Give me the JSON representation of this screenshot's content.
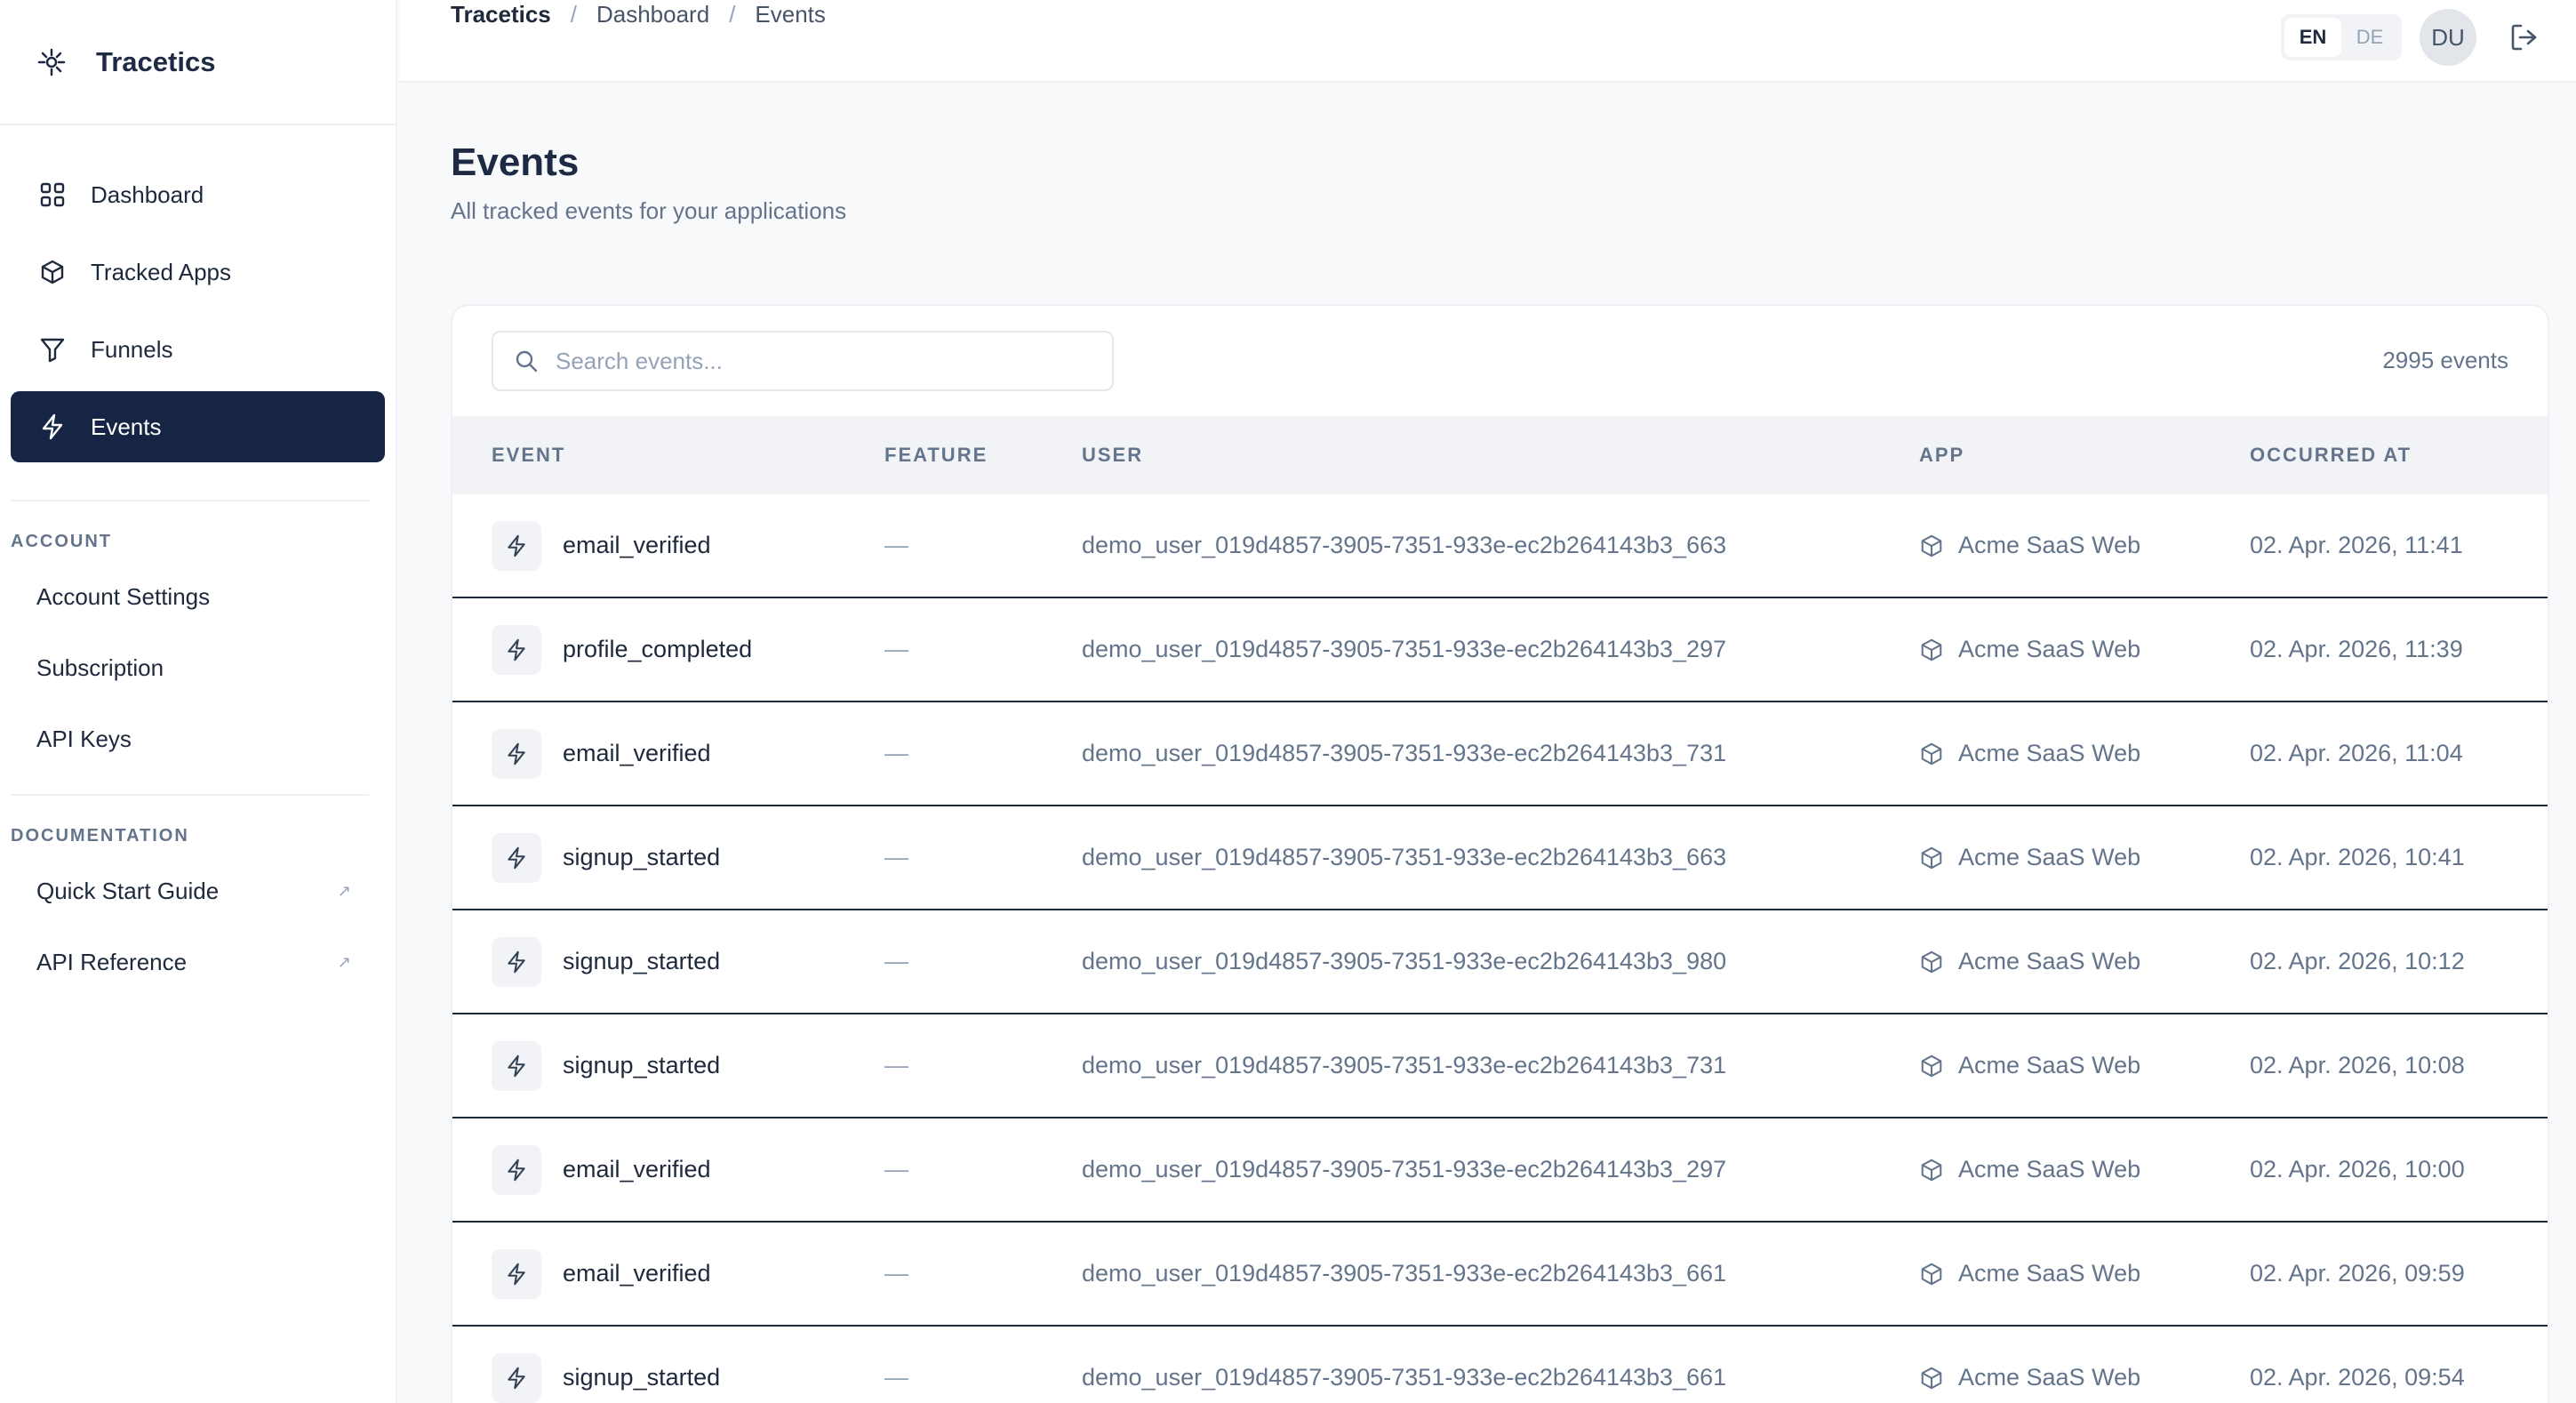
{
  "brand": {
    "name": "Tracetics"
  },
  "sidebar": {
    "nav": [
      {
        "label": "Dashboard",
        "icon": "grid-icon",
        "active": false
      },
      {
        "label": "Tracked Apps",
        "icon": "box-icon",
        "active": false
      },
      {
        "label": "Funnels",
        "icon": "filter-icon",
        "active": false
      },
      {
        "label": "Events",
        "icon": "bolt-icon",
        "active": true
      }
    ],
    "account": {
      "title": "ACCOUNT",
      "items": [
        "Account Settings",
        "Subscription",
        "API Keys"
      ]
    },
    "documentation": {
      "title": "DOCUMENTATION",
      "items": [
        "Quick Start Guide",
        "API Reference"
      ],
      "external_mark": "↗"
    }
  },
  "topbar": {
    "breadcrumb": [
      "Tracetics",
      "Dashboard",
      "Events"
    ],
    "separator": "/",
    "lang": {
      "en": "EN",
      "de": "DE",
      "selected": "EN"
    },
    "avatar": "DU"
  },
  "page": {
    "title": "Events",
    "subtitle": "All tracked events for your applications"
  },
  "search": {
    "placeholder": "Search events...",
    "value": ""
  },
  "count": "2995 events",
  "table": {
    "headers": {
      "event": "EVENT",
      "feature": "FEATURE",
      "user": "USER",
      "app": "APP",
      "time": "OCCURRED AT"
    },
    "rows": [
      {
        "event": "email_verified",
        "feature": "—",
        "user": "demo_user_019d4857-3905-7351-933e-ec2b264143b3_663",
        "app": "Acme SaaS Web",
        "time": "02. Apr. 2026, 11:41"
      },
      {
        "event": "profile_completed",
        "feature": "—",
        "user": "demo_user_019d4857-3905-7351-933e-ec2b264143b3_297",
        "app": "Acme SaaS Web",
        "time": "02. Apr. 2026, 11:39"
      },
      {
        "event": "email_verified",
        "feature": "—",
        "user": "demo_user_019d4857-3905-7351-933e-ec2b264143b3_731",
        "app": "Acme SaaS Web",
        "time": "02. Apr. 2026, 11:04"
      },
      {
        "event": "signup_started",
        "feature": "—",
        "user": "demo_user_019d4857-3905-7351-933e-ec2b264143b3_663",
        "app": "Acme SaaS Web",
        "time": "02. Apr. 2026, 10:41"
      },
      {
        "event": "signup_started",
        "feature": "—",
        "user": "demo_user_019d4857-3905-7351-933e-ec2b264143b3_980",
        "app": "Acme SaaS Web",
        "time": "02. Apr. 2026, 10:12"
      },
      {
        "event": "signup_started",
        "feature": "—",
        "user": "demo_user_019d4857-3905-7351-933e-ec2b264143b3_731",
        "app": "Acme SaaS Web",
        "time": "02. Apr. 2026, 10:08"
      },
      {
        "event": "email_verified",
        "feature": "—",
        "user": "demo_user_019d4857-3905-7351-933e-ec2b264143b3_297",
        "app": "Acme SaaS Web",
        "time": "02. Apr. 2026, 10:00"
      },
      {
        "event": "email_verified",
        "feature": "—",
        "user": "demo_user_019d4857-3905-7351-933e-ec2b264143b3_661",
        "app": "Acme SaaS Web",
        "time": "02. Apr. 2026, 09:59"
      },
      {
        "event": "signup_started",
        "feature": "—",
        "user": "demo_user_019d4857-3905-7351-933e-ec2b264143b3_661",
        "app": "Acme SaaS Web",
        "time": "02. Apr. 2026, 09:54"
      }
    ]
  },
  "colors": {
    "accent": "#162544",
    "muted": "#64748b",
    "border": "#eef0f3"
  }
}
